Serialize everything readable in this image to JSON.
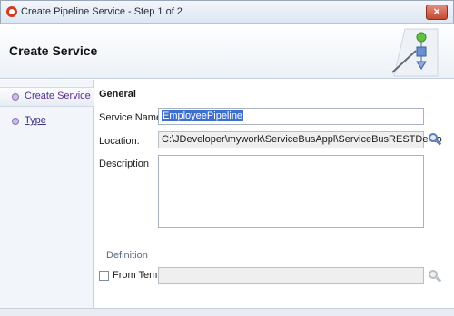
{
  "window": {
    "title": "Create Pipeline Service - Step 1 of 2",
    "close_symbol": "×"
  },
  "header": {
    "title": "Create Service"
  },
  "steps": [
    {
      "label": "Create Service",
      "state": "active"
    },
    {
      "label": "Type",
      "state": "link"
    }
  ],
  "form": {
    "section_title": "General",
    "service_name": {
      "label": "Service Name:",
      "value": "EmployeePipeline"
    },
    "location": {
      "label": "Location:",
      "value": "C:\\JDeveloper\\mywork\\ServiceBusAppl\\ServiceBusRESTDemo"
    },
    "description": {
      "label": "Description",
      "value": ""
    },
    "definition": {
      "label": "Definition",
      "from_template_label": "From Template",
      "from_template_checked": false,
      "template_value": ""
    }
  },
  "icons": {
    "app": "oracle-jdeveloper-icon",
    "close": "close-icon",
    "search": "magnifier-icon",
    "wizard": "pipeline-wizard-graphic"
  },
  "colors": {
    "active_step": "#5b2d8e",
    "selection": "#3d6fcf",
    "close_button": "#c24a32"
  }
}
